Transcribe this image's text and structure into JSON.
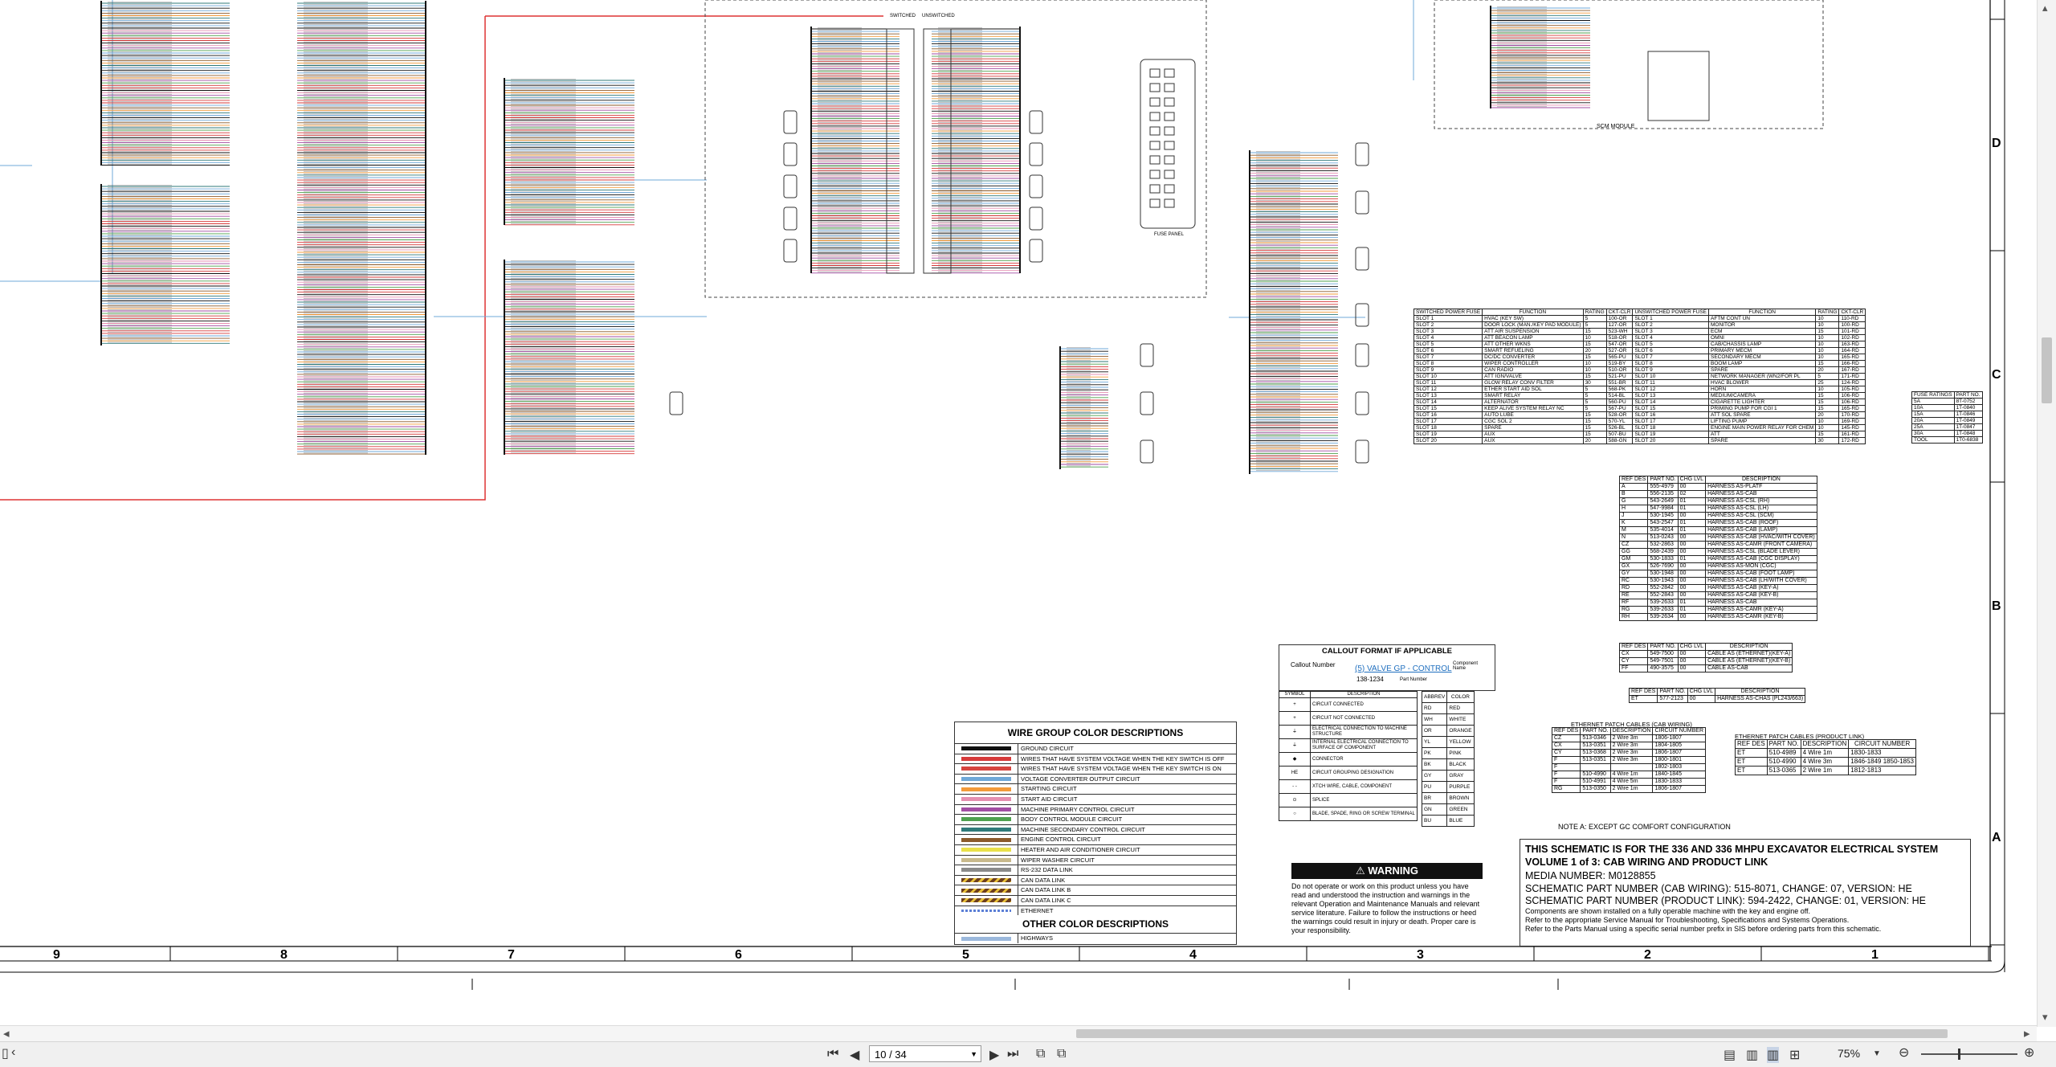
{
  "title_block": {
    "line1": "THIS SCHEMATIC IS FOR THE 336 AND 336 MHPU EXCAVATOR ELECTRICAL SYSTEM",
    "line2": "VOLUME 1 of 3: CAB WIRING AND PRODUCT LINK",
    "line3": "MEDIA NUMBER: M0128855",
    "line4": "SCHEMATIC PART NUMBER (CAB WIRING): 515-8071, CHANGE: 07, VERSION: HE",
    "line5": "SCHEMATIC PART NUMBER (PRODUCT LINK): 594-2422, CHANGE: 01, VERSION: HE",
    "note1": "Components are shown installed on a fully operable machine with the key and engine off.",
    "note2": "Refer to the appropriate Service Manual for Troubleshooting, Specifications and Systems Operations.",
    "note3": "Refer to the Parts Manual using a specific serial number prefix in SIS before ordering parts from this schematic."
  },
  "note_a": "NOTE A: EXCEPT GC COMFORT CONFIGURATION",
  "warning": {
    "title": "WARNING",
    "text": "Do not operate or work on this product unless you have read and understood the instruction and warnings in the relevant Operation and Maintenance Manuals and relevant service literature. Failure to follow the instructions or heed the warnings could result in injury or death. Proper care is your responsibility."
  },
  "wire_group": {
    "title": "WIRE GROUP COLOR DESCRIPTIONS",
    "rows": [
      {
        "color": "#111111",
        "label": "GROUND CIRCUIT"
      },
      {
        "color": "#d63a3a",
        "label": "WIRES THAT HAVE SYSTEM VOLTAGE WHEN THE KEY SWITCH IS OFF"
      },
      {
        "color": "#d6453f",
        "label": "WIRES THAT HAVE SYSTEM VOLTAGE WHEN THE KEY SWITCH IS ON"
      },
      {
        "color": "#6fa8d8",
        "label": "VOLTAGE CONVERTER OUTPUT CIRCUIT"
      },
      {
        "color": "#f39a3a",
        "label": "STARTING CIRCUIT"
      },
      {
        "color": "#e58fb0",
        "label": "START AID CIRCUIT"
      },
      {
        "color": "#a24ea3",
        "label": "MACHINE PRIMARY CONTROL CIRCUIT"
      },
      {
        "color": "#4fa04f",
        "label": "BODY CONTROL MODULE CIRCUIT"
      },
      {
        "color": "#2f7a7a",
        "label": "MACHINE SECONDARY CONTROL CIRCUIT"
      },
      {
        "color": "#8b5a2b",
        "label": "ENGINE CONTROL CIRCUIT"
      },
      {
        "color": "#e9e04a",
        "label": "HEATER AND AIR CONDITIONER CIRCUIT"
      },
      {
        "color": "#c8b98c",
        "label": "WIPER WASHER CIRCUIT"
      },
      {
        "color": "#8a8a8a",
        "label": "RS-232 DATA LINK"
      },
      {
        "color": "#6b3d1e",
        "label": "CAN DATA LINK"
      },
      {
        "color": "#6b3d1e",
        "label": "CAN DATA LINK B"
      },
      {
        "color": "#6b3d1e",
        "label": "CAN DATA LINK C"
      },
      {
        "color": "#5b7fd6",
        "label": "ETHERNET"
      }
    ],
    "other_title": "OTHER COLOR DESCRIPTIONS",
    "other_rows": [
      {
        "color": "#9bb8dc",
        "label": "HIGHWAYS"
      }
    ]
  },
  "callout": {
    "title": "CALLOUT FORMAT IF APPLICABLE",
    "callout_number": "Callout Number",
    "example": "(5) VALVE GP - CONTROL",
    "part": "138-1234",
    "part_label": "Part Number",
    "component_name": "Component Name"
  },
  "symbols": {
    "headers": [
      "SYMBOL",
      "DESCRIPTION"
    ],
    "rows": [
      {
        "sym": "+",
        "desc": "CIRCUIT CONNECTED"
      },
      {
        "sym": "+",
        "desc": "CIRCUIT NOT CONNECTED"
      },
      {
        "sym": "⏚",
        "desc": "ELECTRICAL CONNECTION TO MACHINE STRUCTURE"
      },
      {
        "sym": "⏚",
        "desc": "INTERNAL ELECTRICAL CONNECTION TO SURFACE OF COMPONENT"
      },
      {
        "sym": "◆",
        "desc": "CONNECTOR"
      },
      {
        "sym": "HE",
        "desc": "CIRCUIT GROUPING DESIGNATION"
      },
      {
        "sym": "- -",
        "desc": "XTCH WIRE, CABLE, COMPONENT"
      },
      {
        "sym": "⊙",
        "desc": "SPLICE"
      },
      {
        "sym": "○",
        "desc": "BLADE, SPADE, RING OR SCREW TERMINAL"
      }
    ]
  },
  "colors_table": {
    "headers": [
      "ABBREV",
      "COLOR"
    ],
    "rows": [
      [
        "RD",
        "RED"
      ],
      [
        "WH",
        "WHITE"
      ],
      [
        "OR",
        "ORANGE"
      ],
      [
        "YL",
        "YELLOW"
      ],
      [
        "PK",
        "PINK"
      ],
      [
        "BK",
        "BLACK"
      ],
      [
        "GY",
        "GRAY"
      ],
      [
        "PU",
        "PURPLE"
      ],
      [
        "BR",
        "BROWN"
      ],
      [
        "GN",
        "GREEN"
      ],
      [
        "BU",
        "BLUE"
      ]
    ]
  },
  "ref_des": {
    "headers": [
      "REF DES",
      "PART NO.",
      "CHG LVL",
      "DESCRIPTION"
    ],
    "rows": [
      [
        "A",
        "555-4979",
        "00",
        "HARNESS AS-PLATF"
      ],
      [
        "B",
        "556-2135",
        "02",
        "HARNESS AS-CAB"
      ],
      [
        "G",
        "543-2649",
        "01",
        "HARNESS AS-CSL (RH)"
      ],
      [
        "H",
        "547-9984",
        "01",
        "HARNESS AS-CSL (LH)"
      ],
      [
        "J",
        "530-1945",
        "00",
        "HARNESS AS-CSL (SCM)"
      ],
      [
        "K",
        "543-2547",
        "01",
        "HARNESS AS-CAB (ROOF)"
      ],
      [
        "M",
        "535-4014",
        "01",
        "HARNESS AS-CAB (LAMP)"
      ],
      [
        "N",
        "513-0243",
        "00",
        "HARNESS AS-CAB (HVAC/WITH COVER)"
      ],
      [
        "CZ",
        "532-2863",
        "00",
        "HARNESS AS-CAMR (FRONT CAMERA)"
      ],
      [
        "GG",
        "568-2439",
        "00",
        "HARNESS AS-CSL (BLADE LEVER)"
      ],
      [
        "GM",
        "530-1833",
        "01",
        "HARNESS AS-CAB (CGC DISPLAY)"
      ],
      [
        "GX",
        "526-7690",
        "00",
        "HARNESS AS-MON (CGC)"
      ],
      [
        "GY",
        "530-1948",
        "00",
        "HARNESS AS-CAB (FOOT LAMP)"
      ],
      [
        "RC",
        "530-1943",
        "00",
        "HARNESS AS-CAB (LH/WITH COVER)"
      ],
      [
        "RD",
        "552-2842",
        "00",
        "HARNESS AS-CAB (KEY-A)"
      ],
      [
        "RE",
        "552-2843",
        "00",
        "HARNESS AS-CAB (KEY-B)"
      ],
      [
        "RF",
        "539-2633",
        "01",
        "HARNESS AS-CAB"
      ],
      [
        "RG",
        "539-2633",
        "01",
        "HARNESS AS-CAMR (KEY-A)"
      ],
      [
        "RH",
        "539-2634",
        "00",
        "HARNESS AS-CAMR (KEY-B)"
      ]
    ]
  },
  "cable_table": {
    "headers": [
      "REF DES",
      "PART NO.",
      "CHG LVL",
      "DESCRIPTION"
    ],
    "rows": [
      [
        "CX",
        "549-7500",
        "00",
        "CABLE AS (ETHERNET)(KEY-A)"
      ],
      [
        "CY",
        "549-7501",
        "00",
        "CABLE AS (ETHERNET)(KEY-B)"
      ],
      [
        "FF",
        "490-3575",
        "00",
        "CABLE AS-CAB"
      ]
    ]
  },
  "chas_table": {
    "headers": [
      "REF DES",
      "PART NO.",
      "CHG LVL",
      "DESCRIPTION"
    ],
    "rows": [
      [
        "ET",
        "577-2123",
        "00",
        "HARNESS AS-CHAS (PL243/663)"
      ]
    ]
  },
  "eth_cab": {
    "title": "ETHERNET PATCH CABLES (CAB WIRING)",
    "headers": [
      "REF DES",
      "PART NO.",
      "DESCRIPTION",
      "CIRCUIT NUMBER"
    ],
    "rows": [
      [
        "CZ",
        "513-0346",
        "2 Wire 3m",
        "1806-1807"
      ],
      [
        "CX",
        "513-0351",
        "2 Wire 3m",
        "1804-1805"
      ],
      [
        "CY",
        "513-0368",
        "2 Wire 3m",
        "1806-1807"
      ],
      [
        "F",
        "513-0351",
        "2 Wire 3m",
        "1800-1801"
      ],
      [
        "F",
        "",
        "",
        "1802-1803"
      ],
      [
        "F",
        "510-4990",
        "4 Wire 1m",
        "1840-1845"
      ],
      [
        "F",
        "510-4991",
        "4 Wire 5m",
        "1830-1833"
      ],
      [
        "RG",
        "513-0350",
        "2 Wire 1m",
        "1806-1807"
      ]
    ]
  },
  "eth_pl": {
    "title": "ETHERNET PATCH CABLES (PRODUCT LINK)",
    "headers": [
      "REF DES",
      "PART NO.",
      "DESCRIPTION",
      "CIRCUIT NUMBER"
    ],
    "rows": [
      [
        "ET",
        "510-4989",
        "4 Wire 1m",
        "1830-1833"
      ],
      [
        "ET",
        "510-4990",
        "4 Wire 3m",
        "1846-1849 1850-1853"
      ],
      [
        "ET",
        "513-0365",
        "2 Wire 1m",
        "1812-1813"
      ]
    ]
  },
  "fuse_panel_label": "FUSE PANEL",
  "scm_label": "SCM MODULE",
  "fuse_table": {
    "headers": [
      "SWITCHED POWER FUSE",
      "FUNCTION",
      "RATING",
      "CKT-CLR",
      "UNSWITCHED POWER FUSE",
      "FUNCTION",
      "RATING",
      "CKT-CLR"
    ],
    "rows": [
      [
        "SLOT 1",
        "HVAC (KEY SW)",
        "5",
        "100-OR",
        "SLOT 1",
        "AFTM CONT UN",
        "10",
        "110-RD"
      ],
      [
        "SLOT 2",
        "DOOR LOCK (MAN./KEY PAD MODULE)",
        "5",
        "127-OR",
        "SLOT 2",
        "MONITOR",
        "10",
        "100-RD"
      ],
      [
        "SLOT 3",
        "ATT AIR SUSPENSION",
        "15",
        "523-WH",
        "SLOT 3",
        "ECM",
        "15",
        "101-RD"
      ],
      [
        "SLOT 4",
        "ATT BEACON LAMP",
        "10",
        "518-OR",
        "SLOT 4",
        "OMNI",
        "10",
        "102-RD"
      ],
      [
        "SLOT 5",
        "ATT OTHER WKNS",
        "15",
        "547-OR",
        "SLOT 5",
        "CAB/CHASSIS LAMP",
        "10",
        "163-RD"
      ],
      [
        "SLOT 6",
        "SMART REFUELING",
        "20",
        "527-OR",
        "SLOT 6",
        "PRIMARY MECM",
        "10",
        "164-RD"
      ],
      [
        "SLOT 7",
        "DC/DC CONVERTER",
        "15",
        "565-PU",
        "SLOT 7",
        "SECONDARY MECM",
        "10",
        "165-RD"
      ],
      [
        "SLOT 8",
        "WIPER CONTROLLER",
        "10",
        "519-BY",
        "SLOT 8",
        "BOOM LAMP",
        "15",
        "166-RD"
      ],
      [
        "SLOT 9",
        "CAN RADIO",
        "10",
        "510-OR",
        "SLOT 9",
        "SPARE",
        "20",
        "167-RD"
      ],
      [
        "SLOT 10",
        "ATT IGN/VALVE",
        "15",
        "521-PU",
        "SLOT 10",
        "NETWORK MANAGER (WN2/FOR PL",
        "5",
        "171-RD"
      ],
      [
        "SLOT 11",
        "GLOW RELAY CONV FILTER",
        "30",
        "551-BR",
        "SLOT 11",
        "HVAC BLOWER",
        "25",
        "124-RD"
      ],
      [
        "SLOT 12",
        "ETHER START AID SOL",
        "5",
        "568-PK",
        "SLOT 12",
        "HORN",
        "10",
        "105-RD"
      ],
      [
        "SLOT 13",
        "SMART RELAY",
        "5",
        "514-BL",
        "SLOT 13",
        "MEDIUM/CAMERA",
        "15",
        "106-RD"
      ],
      [
        "SLOT 14",
        "ALTERNATOR",
        "5",
        "560-PU",
        "SLOT 14",
        "CIGARETTE LIGHTER",
        "15",
        "106-RD"
      ],
      [
        "SLOT 15",
        "KEEP ALIVE SYSTEM RELAY NC",
        "5",
        "567-PU",
        "SLOT 15",
        "PRIMING PUMP FOR CGI 1",
        "15",
        "165-RD"
      ],
      [
        "SLOT 16",
        "AUTO LUBE",
        "15",
        "528-OR",
        "SLOT 16",
        "ATT SOL SPARE",
        "20",
        "170-RD"
      ],
      [
        "SLOT 17",
        "CGC SOL 2",
        "15",
        "570-YL",
        "SLOT 17",
        "LIFTING PUMP",
        "10",
        "169-RD"
      ],
      [
        "SLOT 18",
        "SPARE",
        "15",
        "526-BL",
        "SLOT 18",
        "ENGINE MAIN POWER RELAY FOR CHEM",
        "10",
        "145-RD"
      ],
      [
        "SLOT 19",
        "AUX",
        "15",
        "507-BU",
        "SLOT 19",
        "ATT",
        "15",
        "161-RD"
      ],
      [
        "SLOT 20",
        "AUX",
        "20",
        "588-GN",
        "SLOT 20",
        "SPARE",
        "30",
        "172-RD"
      ]
    ]
  },
  "fuse_rating": {
    "headers": [
      "FUSE RATINGS",
      "PART NO."
    ],
    "rows": [
      [
        "5A",
        "8T-0752"
      ],
      [
        "10A",
        "1T-0840"
      ],
      [
        "15A",
        "1T-0846"
      ],
      [
        "20A",
        "1T-0849"
      ],
      [
        "25A",
        "1T-0847"
      ],
      [
        "30A",
        "1T-0848"
      ],
      [
        "TOOL",
        "1T0-6838"
      ]
    ]
  },
  "zones_bottom": [
    "9",
    "8",
    "7",
    "6",
    "5",
    "4",
    "3",
    "2",
    "1"
  ],
  "zones_right": [
    "D",
    "C",
    "B",
    "A"
  ],
  "switched_label": "SWITCHED",
  "unswitched_label": "UNSWITCHED",
  "statusbar": {
    "page_value": "10 / 34",
    "zoom": "75%"
  }
}
